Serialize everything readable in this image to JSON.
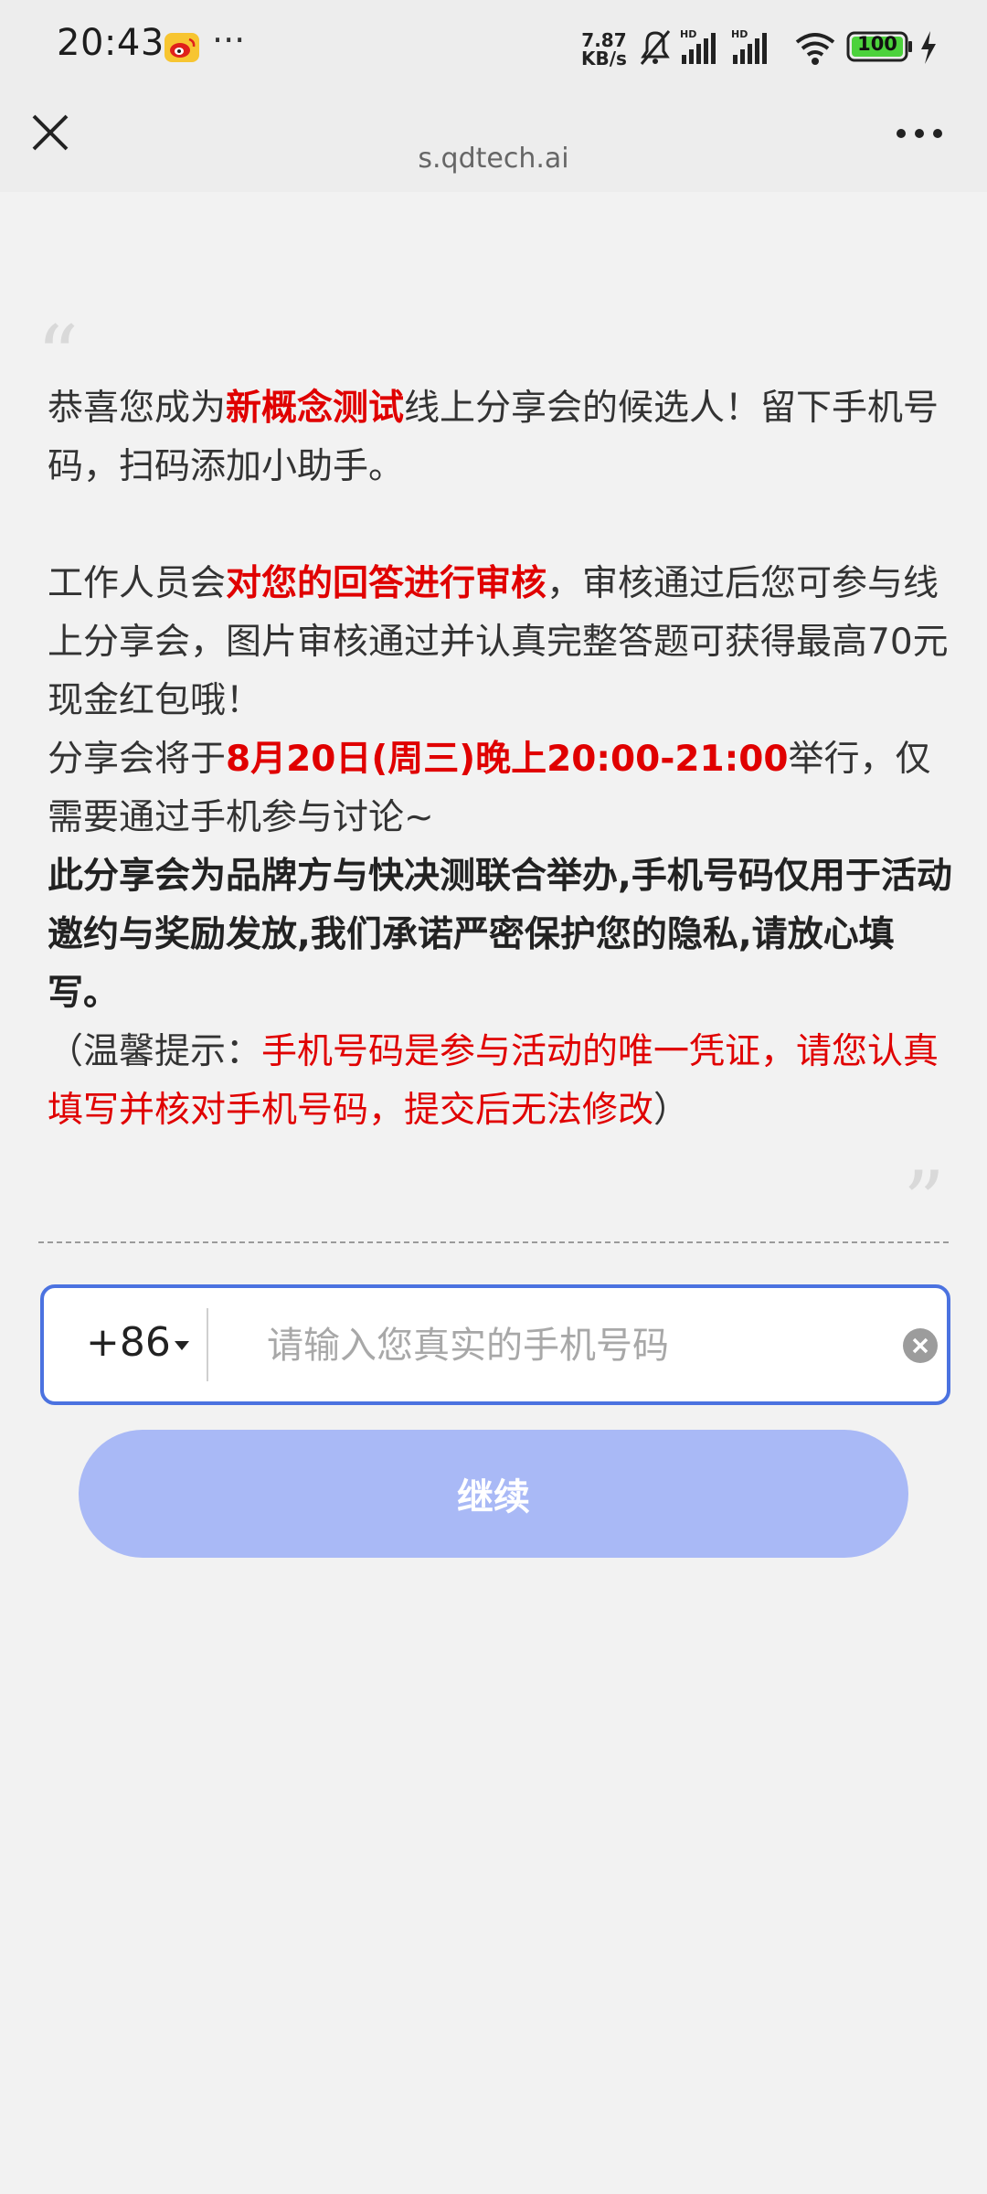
{
  "status_bar": {
    "time": "20:43",
    "dots": "···",
    "net_speed_value": "7.87",
    "net_speed_unit": "KB/s",
    "battery": "100",
    "icons": [
      "weibo-icon",
      "bell-muted-icon",
      "hd-signal-icon",
      "hd-signal-icon",
      "wifi-icon",
      "battery-icon",
      "charging-icon"
    ]
  },
  "nav": {
    "url": "s.qdtech.ai"
  },
  "content": {
    "p1": {
      "t1": "恭喜您成为",
      "t2": "新概念测试",
      "t3": "线上分享会的候选人！留下手机号码，扫码添加小助手。"
    },
    "p2": {
      "t1": "工作人员会",
      "t2": "对您的回答进行审核",
      "t3": "，审核通过后您可参与线上分享会，图片审核通过并认真完整答题可获得最高70元现金红包哦！"
    },
    "p3": {
      "t1": "分享会将于",
      "t2": "8月20日(周三)晚上20:00-21:00",
      "t3": "举行，仅需要通过手机参与讨论~"
    },
    "p4": "此分享会为品牌方与快决测联合举办,手机号码仅用于活动邀约与奖励发放,我们承诺严密保护您的隐私,请放心填写。",
    "p5": {
      "t1": "（温馨提示：",
      "t2": "手机号码是参与活动的唯一凭证，请您认真填写并核对手机号码，提交后无法修改",
      "t3": "）"
    }
  },
  "form": {
    "country_code": "+86",
    "phone_placeholder": "请输入您真实的手机号码",
    "phone_value": "",
    "continue_label": "继续"
  },
  "colors": {
    "accent": "#4b72e0",
    "button": "#a9b9f6",
    "highlight": "#e00000"
  }
}
